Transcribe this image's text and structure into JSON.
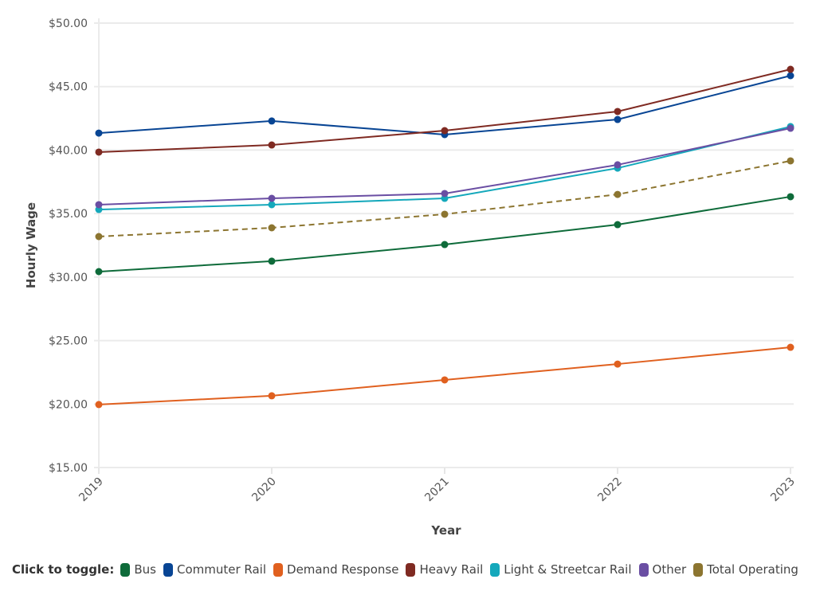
{
  "chart_data": {
    "type": "line",
    "title": "",
    "xlabel": "Year",
    "ylabel": "Hourly Wage",
    "x": [
      "2019",
      "2020",
      "2021",
      "2022",
      "2023"
    ],
    "ylim": [
      15,
      50
    ],
    "yticks": [
      15,
      20,
      25,
      30,
      35,
      40,
      45,
      50
    ],
    "ytick_labels": [
      "$15.00",
      "$20.00",
      "$25.00",
      "$30.00",
      "$35.00",
      "$40.00",
      "$45.00",
      "$50.00"
    ],
    "grid": true,
    "legend_placement": "bottom",
    "legend_title": "Click to toggle:",
    "series": [
      {
        "name": "Bus",
        "color": "#0e6b3a",
        "dashed": false,
        "values": [
          30.43,
          31.25,
          32.56,
          34.13,
          36.33
        ]
      },
      {
        "name": "Commuter Rail",
        "color": "#084594",
        "dashed": false,
        "values": [
          41.34,
          42.29,
          41.22,
          42.41,
          45.86
        ]
      },
      {
        "name": "Demand Response",
        "color": "#e0601f",
        "dashed": false,
        "values": [
          19.96,
          20.65,
          21.9,
          23.15,
          24.47
        ]
      },
      {
        "name": "Heavy Rail",
        "color": "#7f2a22",
        "dashed": false,
        "values": [
          39.84,
          40.4,
          41.53,
          43.04,
          46.36
        ]
      },
      {
        "name": "Light & Streetcar Rail",
        "color": "#14a8bb",
        "dashed": false,
        "values": [
          35.32,
          35.7,
          36.2,
          38.58,
          41.85
        ]
      },
      {
        "name": "Other",
        "color": "#6a4ea3",
        "dashed": false,
        "values": [
          35.7,
          36.2,
          36.58,
          38.84,
          41.72
        ]
      },
      {
        "name": "Total Operating",
        "color": "#8c7530",
        "dashed": true,
        "values": [
          33.19,
          33.88,
          34.95,
          36.51,
          39.15
        ]
      }
    ]
  }
}
